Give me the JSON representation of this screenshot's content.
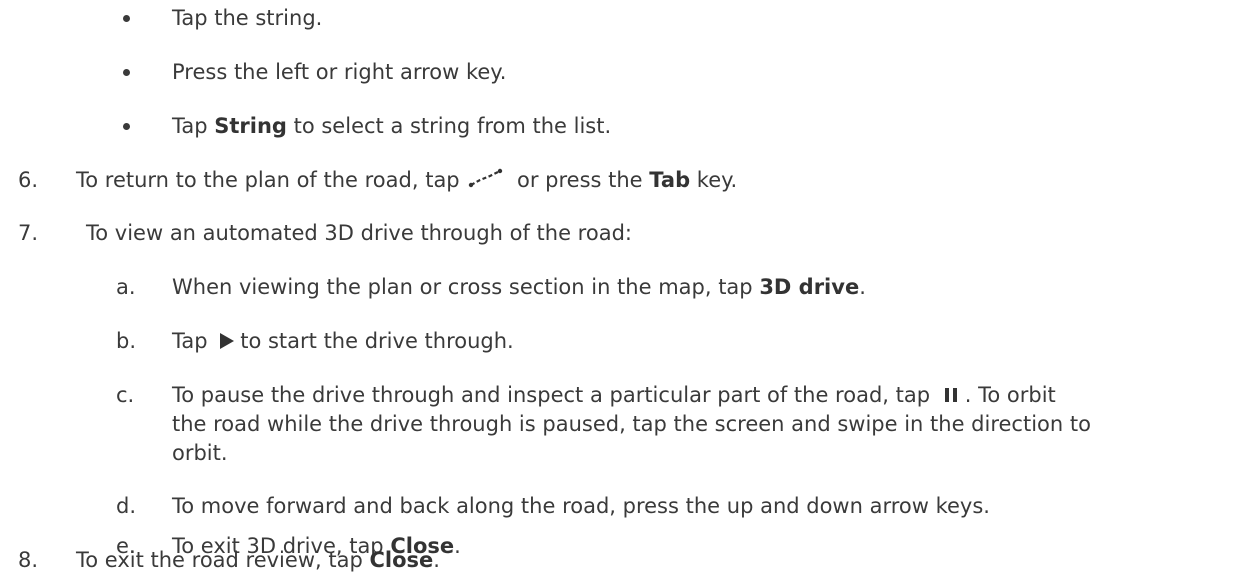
{
  "bullets": [
    "Tap the string.",
    "Press the left or right arrow key.",
    {
      "pre": "Tap ",
      "bold": "String",
      "post": " to select a string from the list."
    }
  ],
  "step6": {
    "num": "6.",
    "pre": "To return to the plan of the road, tap ",
    "icon": "polyline-icon",
    "mid": " or press the ",
    "bold": "Tab",
    "post": " key."
  },
  "step7": {
    "num": "7.",
    "text": "To view an automated 3D drive through of the road:",
    "subs": {
      "a": {
        "label": "a.",
        "pre": "When viewing the plan or cross section in the map, tap ",
        "bold": "3D drive",
        "post": "."
      },
      "b": {
        "label": "b.",
        "pre": "Tap ",
        "icon": "play-icon",
        "post": "to start the drive through."
      },
      "c": {
        "label": "c.",
        "pre": "To pause the drive through and inspect a particular part of the road, tap ",
        "icon": "pause-icon",
        "line1_post": ". To orbit",
        "line2": "the road while the drive through is paused, tap the screen and swipe in the direction to",
        "line3": "orbit."
      },
      "d": {
        "label": "d.",
        "text": "To move forward and back along the road, press the up and down arrow keys."
      },
      "e": {
        "label": "e.",
        "pre": "To exit 3D drive, tap ",
        "bold": "Close",
        "post": "."
      }
    }
  },
  "step8": {
    "num": "8.",
    "pre": "To exit the road review, tap ",
    "bold": "Close",
    "post": "."
  }
}
